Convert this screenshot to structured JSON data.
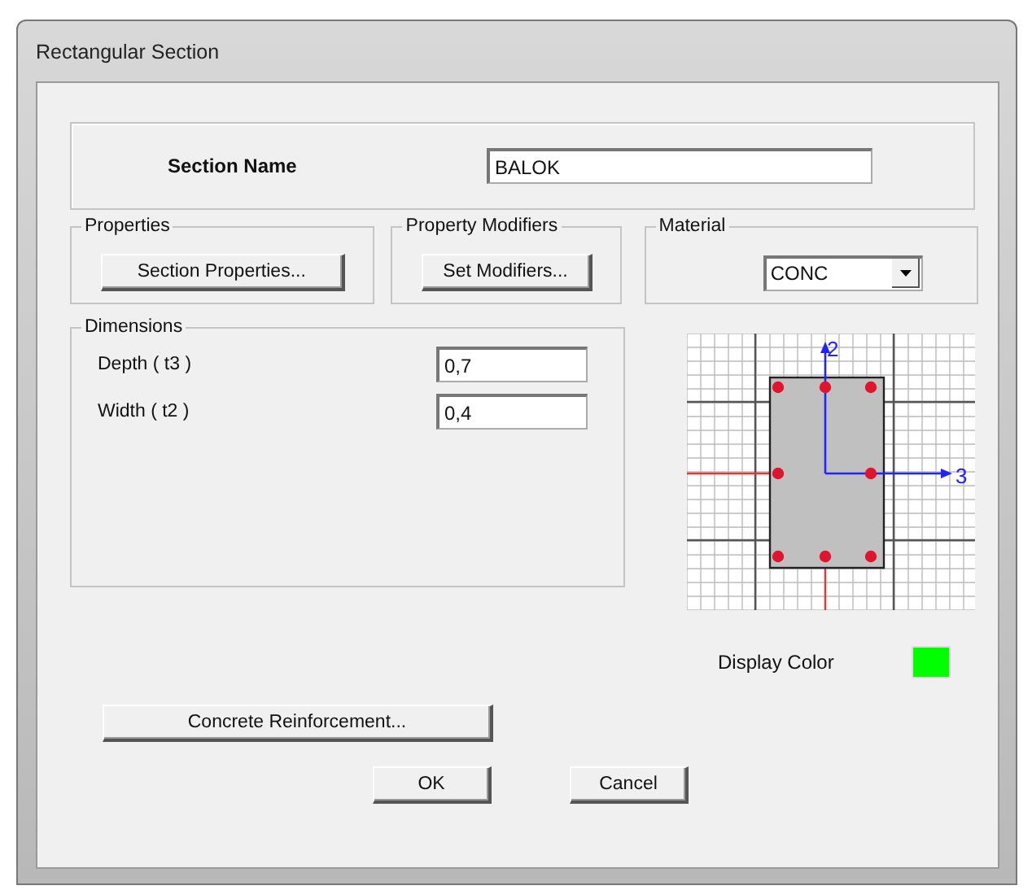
{
  "window": {
    "title": "Rectangular Section"
  },
  "section_name": {
    "label": "Section Name",
    "value": "BALOK"
  },
  "properties": {
    "title": "Properties",
    "button": "Section Properties..."
  },
  "property_modifiers": {
    "title": "Property Modifiers",
    "button": "Set Modifiers..."
  },
  "material": {
    "title": "Material",
    "value": "CONC"
  },
  "dimensions": {
    "title": "Dimensions",
    "fields": [
      {
        "label": "Depth  ( t3 )",
        "value": "0,7"
      },
      {
        "label": "Width  ( t2 )",
        "value": "0,4"
      }
    ]
  },
  "section_view": {
    "axis_vertical": "2",
    "axis_horizontal": "3"
  },
  "display_color": {
    "label": "Display Color",
    "color": "#00ff00"
  },
  "reinforcement_button": "Concrete Reinforcement...",
  "buttons": [
    "OK",
    "Cancel"
  ]
}
